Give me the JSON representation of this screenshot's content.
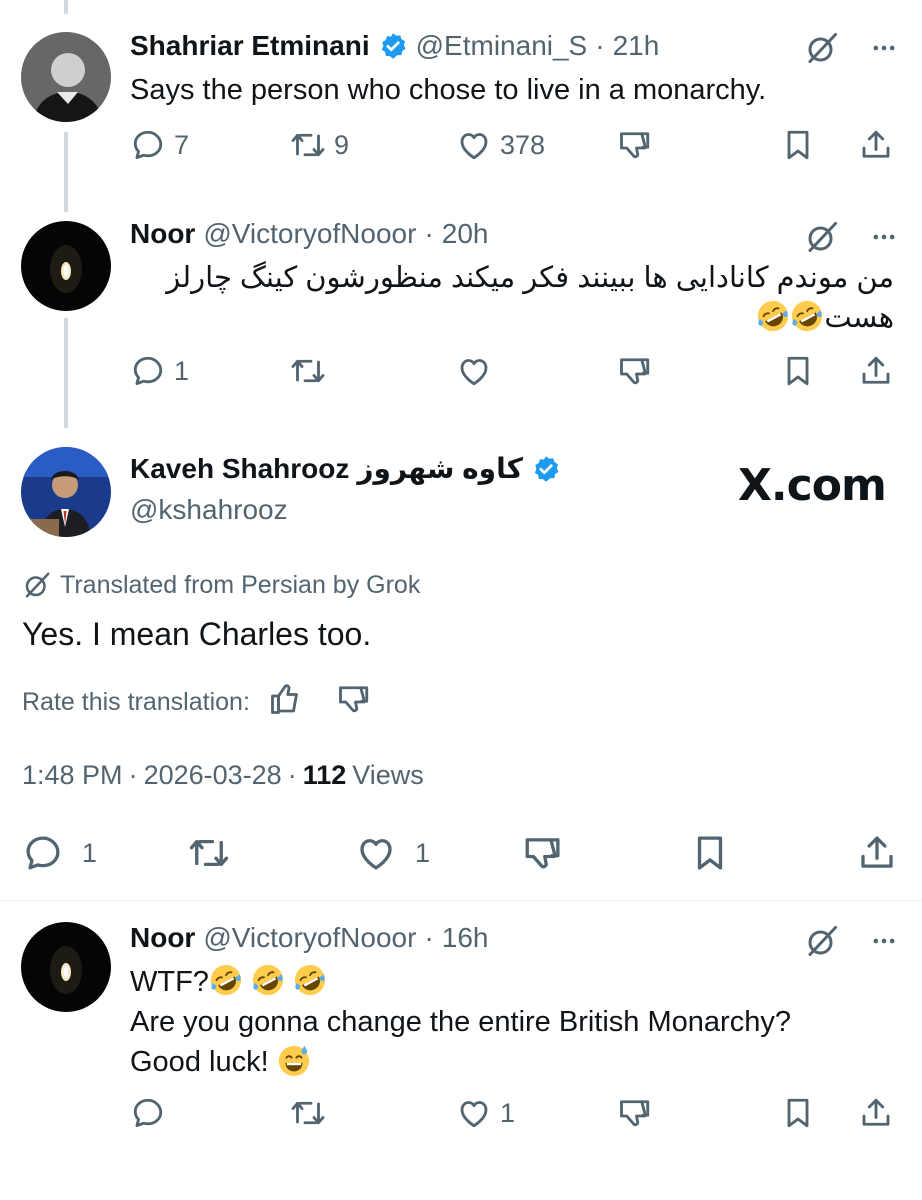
{
  "watermark": "X.com",
  "colors": {
    "verified": "#1d9bf0",
    "text": "#0f1419",
    "muted": "#536471"
  },
  "replies": [
    {
      "name": "Shahriar Etminani",
      "handle": "@Etminani_S",
      "sep": "·",
      "time": "21h",
      "text": "Says the person who chose to live in a monarchy.",
      "counts": {
        "reply": "7",
        "repost": "9",
        "like": "378"
      }
    },
    {
      "name": "Noor",
      "handle": "@VictoryofNooor",
      "sep": "·",
      "time": "20h",
      "text_line1": "من موندم کانادایی ها ببینند فکر میکند منظورشون کینگ چارلز",
      "text_line2": "هست",
      "counts": {
        "reply": "1"
      }
    }
  ],
  "main": {
    "name": "Kaveh Shahrooz",
    "name_fa": "کاوه شهروز",
    "handle": "@kshahrooz",
    "translated_label": "Translated from Persian by Grok",
    "text": "Yes. I mean Charles too.",
    "rate_label": "Rate this translation:",
    "time": "1:48 PM",
    "date": "2026-03-28",
    "sep": "·",
    "views_count": "112",
    "views_label": "Views",
    "counts": {
      "reply": "1",
      "like": "1"
    }
  },
  "reply3": {
    "name": "Noor",
    "handle": "@VictoryofNooor",
    "sep": "·",
    "time": "16h",
    "line1": "WTF?",
    "line2": "Are you gonna change the entire British Monarchy?",
    "line3": "Good luck!",
    "counts": {
      "like": "1"
    }
  }
}
